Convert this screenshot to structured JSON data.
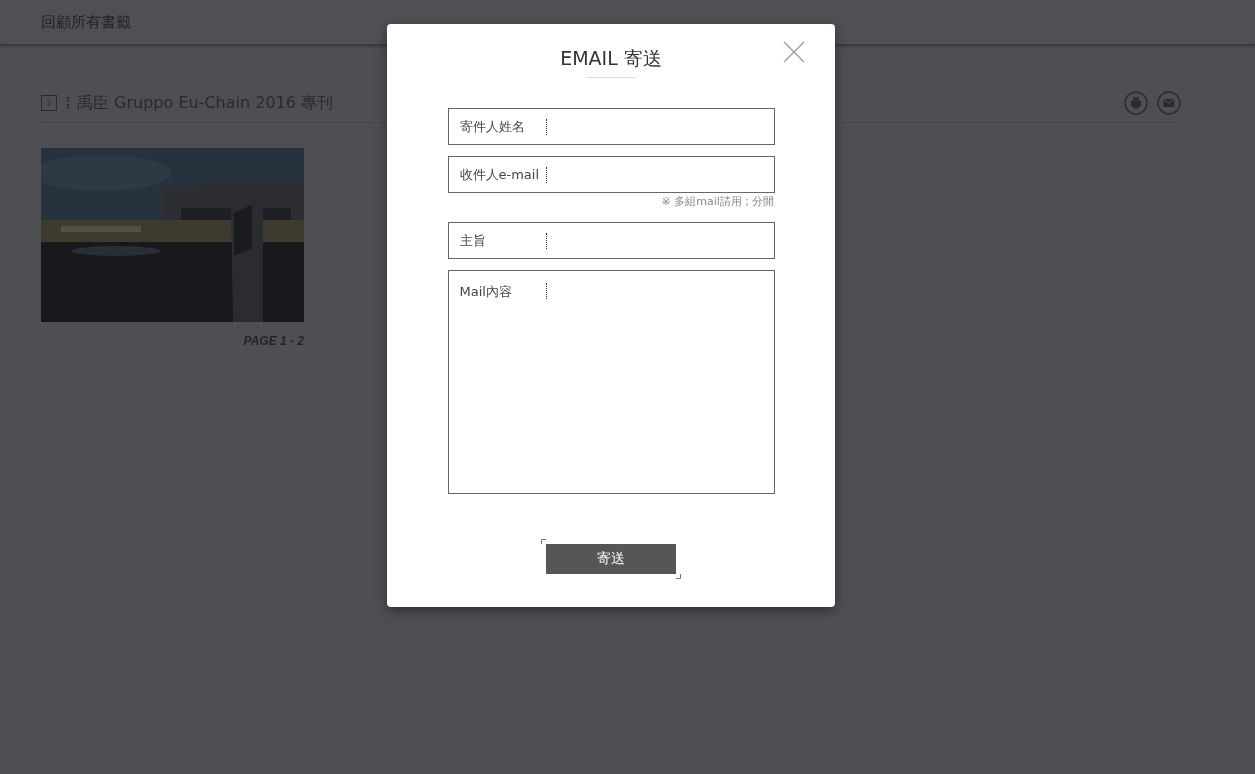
{
  "header": {
    "title": "回顧所有書籤"
  },
  "bookmark": {
    "title": "禹臣 Gruppo Eu-Chain 2016 專刊",
    "page_label": "PAGE 1 - 2"
  },
  "modal": {
    "title": "EMAIL 寄送",
    "fields": [
      {
        "kind": "line",
        "label": "寄件人姓名"
      },
      {
        "kind": "line",
        "label": "收件人e-mail",
        "hint": "※ 多組mail請用 ; 分開"
      },
      {
        "kind": "line",
        "label": "主旨"
      },
      {
        "kind": "area",
        "label": "Mail內容"
      }
    ],
    "submit": "寄送"
  }
}
